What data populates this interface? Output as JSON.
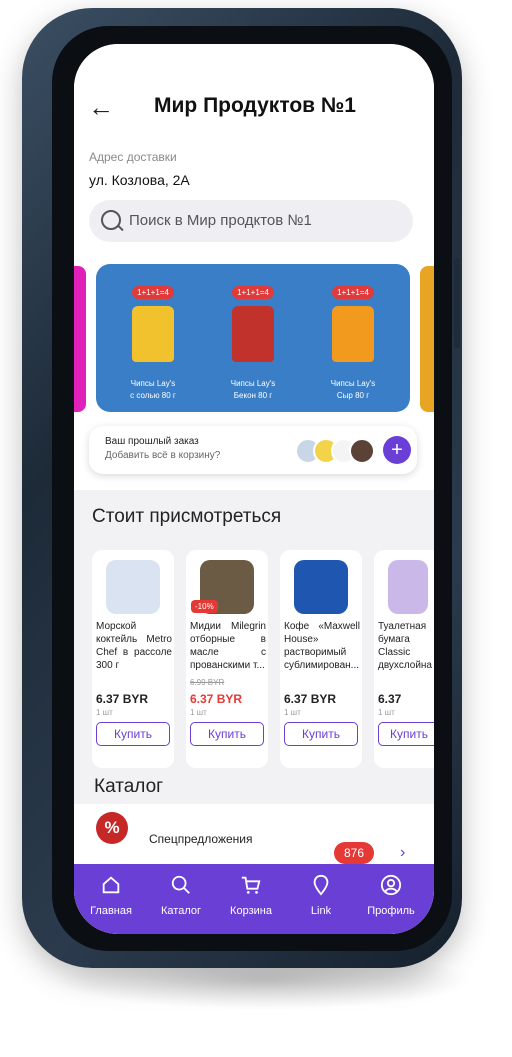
{
  "header": {
    "back_icon": "arrow-left-icon",
    "title": "Мир Продуктов №1"
  },
  "address": {
    "label": "Адрес доставки",
    "value": "ул. Козлова, 2А"
  },
  "search": {
    "placeholder": "Поиск в Мир продктов №1",
    "icon": "search-icon"
  },
  "promo": {
    "background": "#3a7ec8",
    "items": [
      {
        "badge": "1+1+1=4",
        "caption_line1": "Чипсы Lay's",
        "caption_line2": "с солью 80 г",
        "color": "#f2c12e"
      },
      {
        "badge": "1+1+1=4",
        "caption_line1": "Чипсы Lay's",
        "caption_line2": "Бекон 80 г",
        "color": "#c0322b"
      },
      {
        "badge": "1+1+1=4",
        "caption_line1": "Чипсы Lay's",
        "caption_line2": "Сыр 80 г",
        "color": "#f29a1e"
      }
    ]
  },
  "last_order": {
    "title": "Ваш прошлый заказ",
    "subtitle": "Добавить всё в корзину?",
    "add_icon": "plus-icon"
  },
  "recommended": {
    "title": "Стоит присмотреться",
    "buy_label": "Купить",
    "products": [
      {
        "name": "Морской коктейль Metro Chef в рассоле 300 г",
        "old_price": "",
        "price": "6.37 BYR",
        "unit": "1 шт",
        "discount": "",
        "price_red": false,
        "img_color": "#d9e3f1"
      },
      {
        "name": "Мидии Milegrin отборные в масле с прованскими т...",
        "old_price": "6.99 BYR",
        "price": "6.37 BYR",
        "unit": "1 шт",
        "discount": "-10%",
        "price_red": true,
        "img_color": "#6b5a44"
      },
      {
        "name": "Кофе «Maxwell House» растворимый сублимирован...",
        "old_price": "",
        "price": "6.37 BYR",
        "unit": "1 шт",
        "discount": "",
        "price_red": false,
        "img_color": "#1f56b0"
      },
      {
        "name": "Туалетная бумага Classic двухслойная",
        "old_price": "",
        "price": "6.37",
        "unit": "1 шт",
        "discount": "",
        "price_red": false,
        "img_color": "#c9b8e8"
      }
    ]
  },
  "catalog": {
    "title": "Каталог",
    "item_label": "Спецпредложения",
    "item_icon": "percent-icon",
    "badge": "876",
    "chevron": "›"
  },
  "nav": {
    "items": [
      {
        "label": "Главная",
        "icon": "home-icon"
      },
      {
        "label": "Каталог",
        "icon": "search-icon"
      },
      {
        "label": "Корзина",
        "icon": "cart-icon"
      },
      {
        "label": "Link",
        "icon": "link-icon"
      },
      {
        "label": "Профиль",
        "icon": "profile-icon"
      }
    ]
  },
  "colors": {
    "accent": "#6a3fd6",
    "sale": "#e53935"
  }
}
